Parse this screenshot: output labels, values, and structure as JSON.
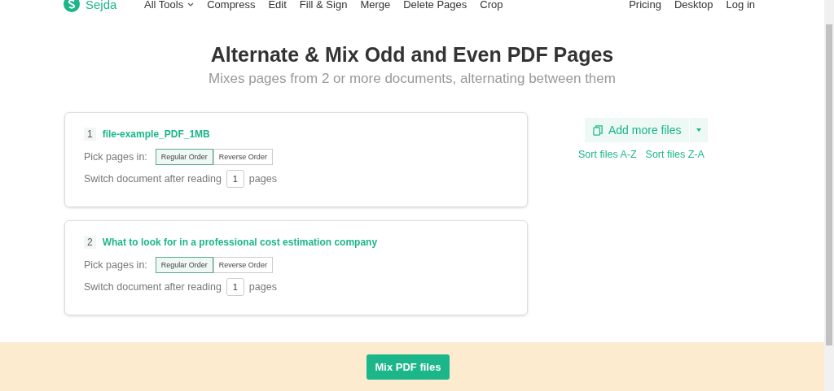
{
  "header": {
    "logo": "Sejda",
    "nav": [
      {
        "label": "All Tools",
        "dropdown": true
      },
      {
        "label": "Compress",
        "dropdown": false
      },
      {
        "label": "Edit",
        "dropdown": false
      },
      {
        "label": "Fill & Sign",
        "dropdown": false
      },
      {
        "label": "Merge",
        "dropdown": false
      },
      {
        "label": "Delete Pages",
        "dropdown": false
      },
      {
        "label": "Crop",
        "dropdown": false
      }
    ],
    "right_nav": [
      "Pricing",
      "Desktop",
      "Log in"
    ]
  },
  "title": "Alternate & Mix Odd and Even PDF Pages",
  "subtitle": "Mixes pages from 2 or more documents, alternating between them",
  "files": [
    {
      "index": "1",
      "name": "file-example_PDF_1MB",
      "pick_label": "Pick pages in:",
      "orders": [
        {
          "label": "Regular Order",
          "selected": true
        },
        {
          "label": "Reverse Order",
          "selected": false
        }
      ],
      "switch_label": "Switch document after reading",
      "pages_value": "1",
      "pages_suffix": "pages"
    },
    {
      "index": "2",
      "name": "What to look for in a professional cost estimation company",
      "pick_label": "Pick pages in:",
      "orders": [
        {
          "label": "Regular Order",
          "selected": true
        },
        {
          "label": "Reverse Order",
          "selected": false
        }
      ],
      "switch_label": "Switch document after reading",
      "pages_value": "1",
      "pages_suffix": "pages"
    }
  ],
  "add_more": "Add more files",
  "sort_links": [
    "Sort files A-Z",
    "Sort files Z-A"
  ],
  "submit": "Mix PDF files"
}
